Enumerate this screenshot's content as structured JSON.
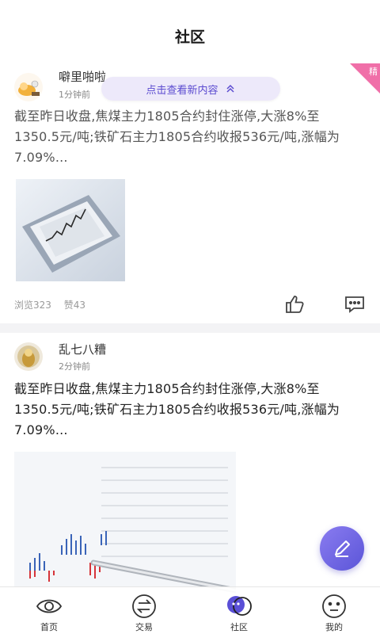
{
  "header": {
    "title": "社区"
  },
  "new_content_pill": {
    "label": "点击查看新内容"
  },
  "posts": [
    {
      "username": "噼里啪啦",
      "time": "1分钟前",
      "text": "截至昨日收盘,焦煤主力1805合约封住涨停,大涨8%至1350.5元/吨;铁矿石主力1805合约收报536元/吨,涨幅为7.09%...",
      "views": "浏览323",
      "likes": "赞43",
      "badge": "精"
    },
    {
      "username": "乱七八糟",
      "time": "2分钟前",
      "text": "截至昨日收盘,焦煤主力1805合约封住涨停,大涨8%至1350.5元/吨;铁矿石主力1805合约收报536元/吨,涨幅为7.09%..."
    }
  ],
  "tabs": [
    {
      "label": "首页",
      "icon": "eye-icon"
    },
    {
      "label": "交易",
      "icon": "exchange-icon"
    },
    {
      "label": "社区",
      "icon": "community-icon"
    },
    {
      "label": "我的",
      "icon": "face-icon"
    }
  ],
  "colors": {
    "accent": "#5b4bd0",
    "badge": "#f06fa8",
    "fab": "#6b60e0"
  }
}
